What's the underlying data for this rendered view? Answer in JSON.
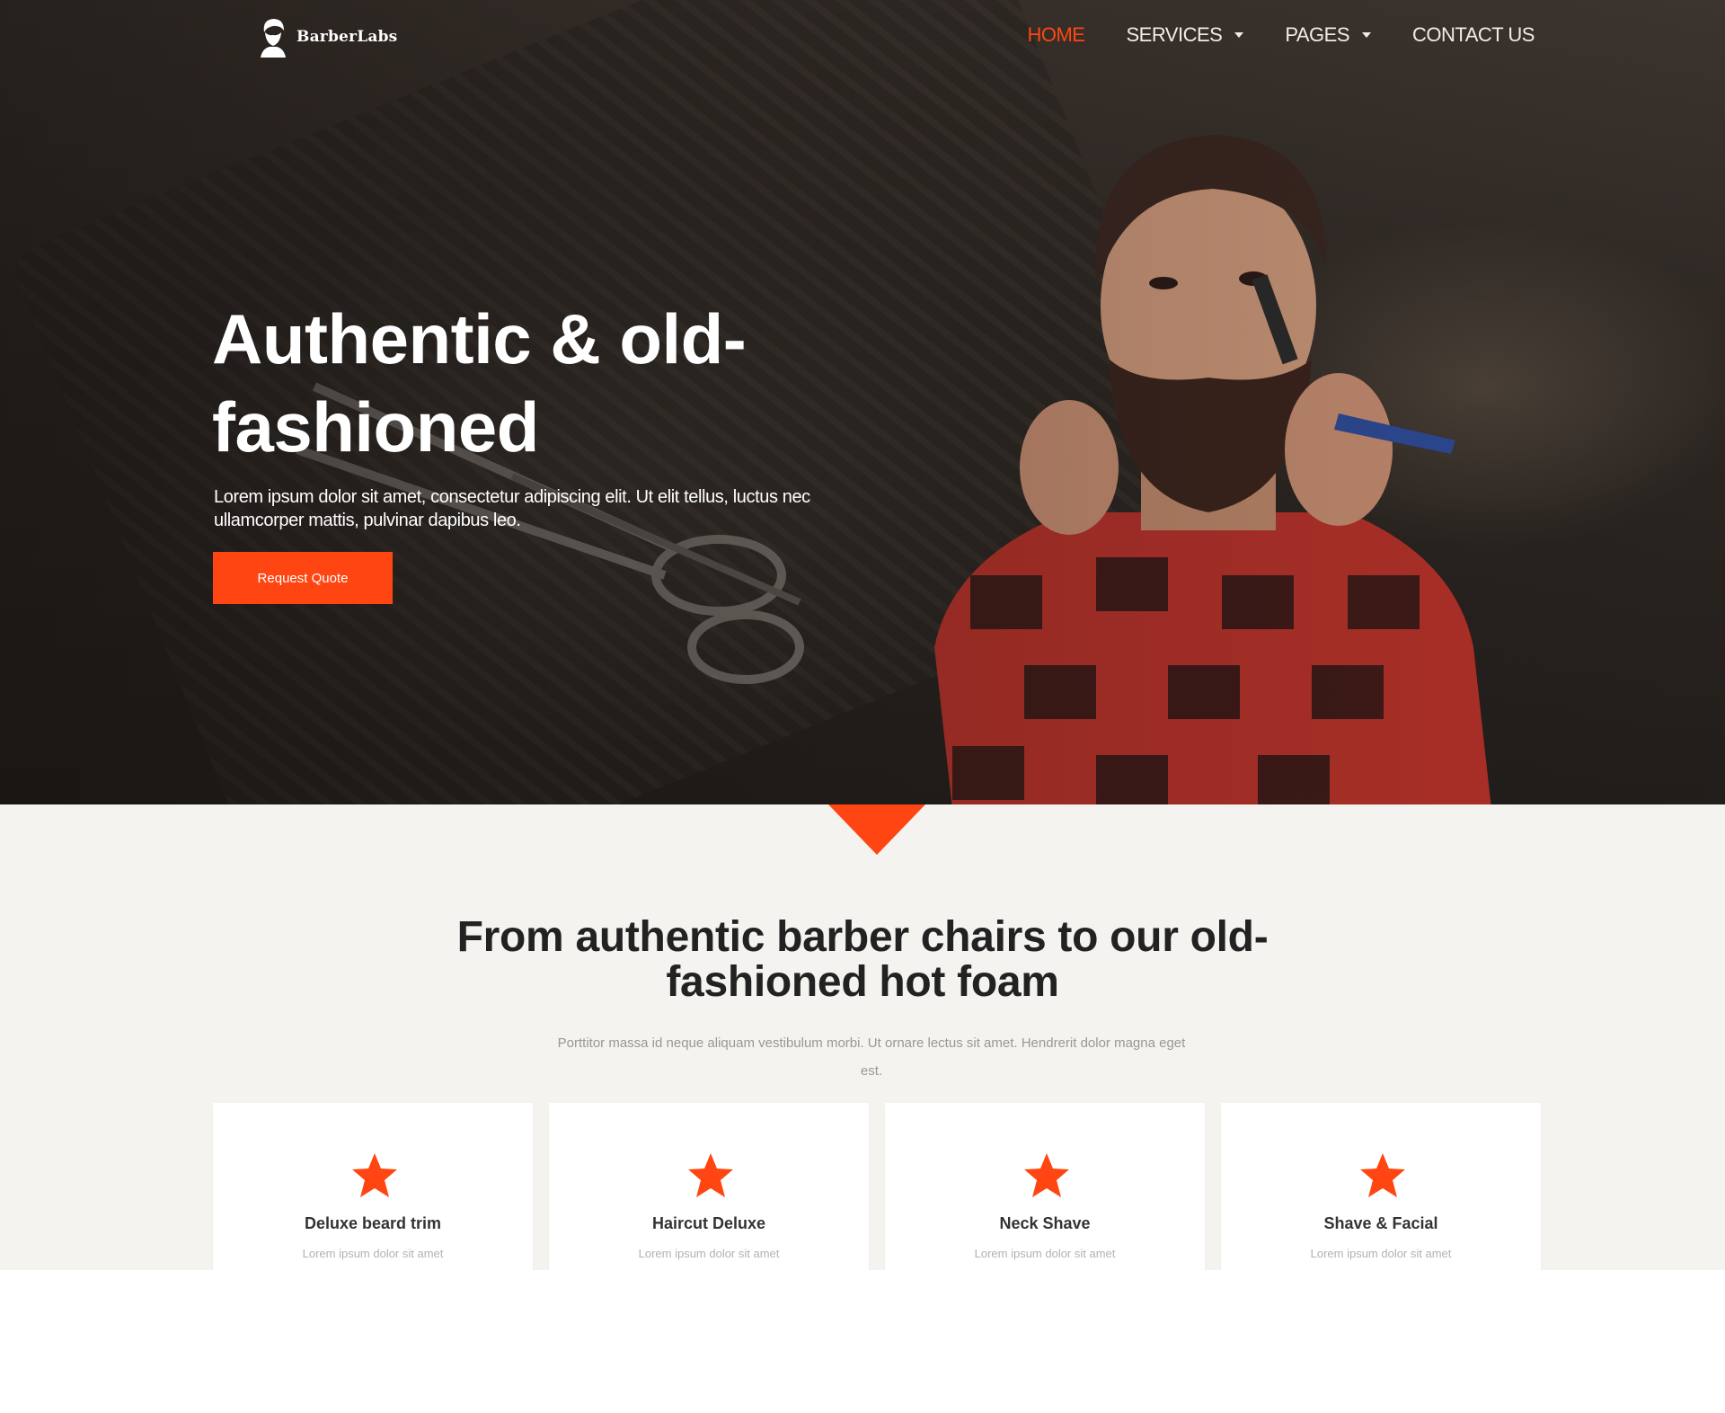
{
  "brand": {
    "name": "BarberLabs"
  },
  "nav": {
    "items": [
      {
        "label": "HOME",
        "active": true,
        "dropdown": false
      },
      {
        "label": "SERVICES",
        "active": false,
        "dropdown": true
      },
      {
        "label": "PAGES",
        "active": false,
        "dropdown": true
      },
      {
        "label": "CONTACT US",
        "active": false,
        "dropdown": false
      }
    ]
  },
  "hero": {
    "title": "Authentic & old-fashioned",
    "description": "Lorem ipsum dolor sit amet, consectetur adipiscing elit. Ut elit tellus, luctus nec ullamcorper mattis, pulvinar dapibus leo.",
    "cta_label": "Request Quote"
  },
  "services": {
    "title": "From authentic barber chairs to our old-fashioned hot foam",
    "description": "Porttitor massa id neque aliquam vestibulum morbi. Ut ornare lectus sit amet. Hendrerit dolor magna eget est.",
    "cards": [
      {
        "icon": "star-icon",
        "title": "Deluxe beard trim",
        "text": "Lorem ipsum dolor sit amet"
      },
      {
        "icon": "star-icon",
        "title": "Haircut Deluxe",
        "text": "Lorem ipsum dolor sit amet"
      },
      {
        "icon": "star-icon",
        "title": "Neck Shave",
        "text": "Lorem ipsum dolor sit amet"
      },
      {
        "icon": "star-icon",
        "title": "Shave & Facial",
        "text": "Lorem ipsum dolor sit amet"
      }
    ]
  },
  "colors": {
    "accent": "#ff4612",
    "section_bg": "#f5f3f0",
    "heading": "#222222"
  }
}
